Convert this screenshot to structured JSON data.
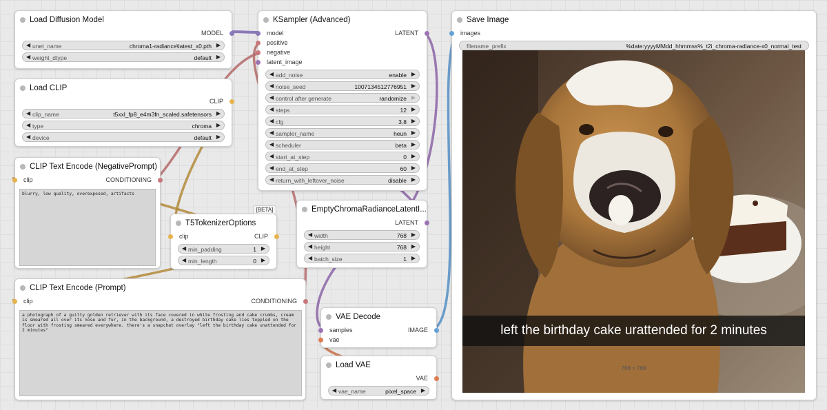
{
  "colors": {
    "model": "#8b7ab8",
    "clip": "#e6b34c",
    "conditioning": "#c9777b",
    "latent": "#9c72b5",
    "image": "#64a2d8",
    "vae": "#e07b4f"
  },
  "nodes": {
    "load_diffusion_model": {
      "title": "Load Diffusion Model",
      "output": "MODEL",
      "widgets": [
        {
          "name": "unet_name",
          "value": "chroma1-radiance\\latest_x0.pth"
        },
        {
          "name": "weight_dtype",
          "value": "default"
        }
      ]
    },
    "load_clip": {
      "title": "Load CLIP",
      "output": "CLIP",
      "widgets": [
        {
          "name": "clip_name",
          "value": "t5xxl_fp8_e4m3fn_scaled.safetensors"
        },
        {
          "name": "type",
          "value": "chroma"
        },
        {
          "name": "device",
          "value": "default"
        }
      ]
    },
    "clip_negative": {
      "title": "CLIP Text Encode (NegativePrompt)",
      "input": "clip",
      "output": "CONDITIONING",
      "text": "blurry, low quality, overexposed, artifacts"
    },
    "t5_tokenizer": {
      "badge": "[BETA]",
      "title": "T5TokenizerOptions",
      "input": "clip",
      "output": "CLIP",
      "widgets": [
        {
          "name": "min_padding",
          "value": "1"
        },
        {
          "name": "min_length",
          "value": "0"
        }
      ]
    },
    "clip_prompt": {
      "title": "CLIP Text Encode (Prompt)",
      "input": "clip",
      "output": "CONDITIONING",
      "text": "a photograph of a guilty golden retriever with its face covered in white frosting and cake crumbs, cream is smeared all over its nose and fur, in the background, a destroyed birthday cake lies toppled on the floor with frosting smeared everywhere. there's a snapchat overlay \"left the birthday cake unattended for 2 minutes\""
    },
    "ksampler": {
      "title": "KSampler (Advanced)",
      "inputs": [
        "model",
        "positive",
        "negative",
        "latent_image"
      ],
      "output": "LATENT",
      "widgets": [
        {
          "name": "add_noise",
          "value": "enable"
        },
        {
          "name": "noise_seed",
          "value": "1007134512776951"
        },
        {
          "name": "control after generate",
          "value": "randomize"
        },
        {
          "name": "steps",
          "value": "12"
        },
        {
          "name": "cfg",
          "value": "3.8"
        },
        {
          "name": "sampler_name",
          "value": "heun"
        },
        {
          "name": "scheduler",
          "value": "beta"
        },
        {
          "name": "start_at_step",
          "value": "0"
        },
        {
          "name": "end_at_step",
          "value": "60"
        },
        {
          "name": "return_with_leftover_noise",
          "value": "disable"
        }
      ]
    },
    "empty_latent": {
      "title": "EmptyChromaRadianceLatentI...",
      "output": "LATENT",
      "widgets": [
        {
          "name": "width",
          "value": "768"
        },
        {
          "name": "height",
          "value": "768"
        },
        {
          "name": "batch_size",
          "value": "1"
        }
      ]
    },
    "vae_decode": {
      "title": "VAE Decode",
      "inputs": [
        "samples",
        "vae"
      ],
      "output": "IMAGE"
    },
    "load_vae": {
      "title": "Load VAE",
      "output": "VAE",
      "widgets": [
        {
          "name": "vae_name",
          "value": "pixel_space"
        }
      ]
    },
    "save_image": {
      "title": "Save Image",
      "input": "images",
      "prefix_name": "filename_prefix",
      "prefix_value": "%date:yyyyMMdd_hhmmss%_t2i_chroma-radiance-x0_normal_test",
      "caption": "left the birthday cake urattended for 2 minutes",
      "image_size": "768 × 768"
    }
  }
}
